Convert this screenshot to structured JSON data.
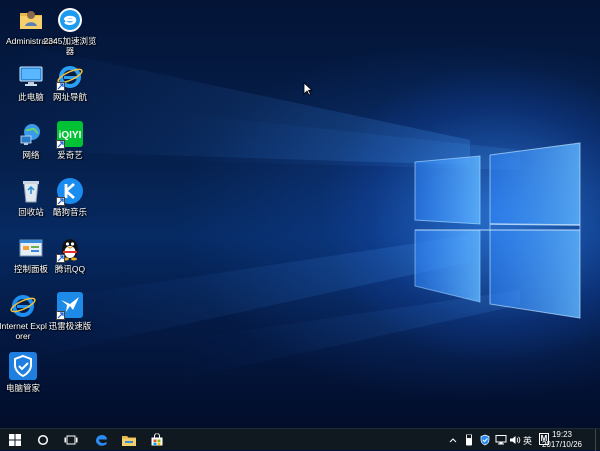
{
  "desktop": {
    "icons": [
      {
        "label": "Administrator",
        "icon": "user-folder-icon"
      },
      {
        "label": "2345加速浏览器",
        "icon": "browser-2345-icon"
      },
      {
        "label": "此电脑",
        "icon": "this-pc-icon"
      },
      {
        "label": "网址导航",
        "icon": "ie-navigation-icon"
      },
      {
        "label": "网络",
        "icon": "network-icon"
      },
      {
        "label": "爱奇艺",
        "icon": "iqiyi-icon"
      },
      {
        "label": "回收站",
        "icon": "recycle-bin-icon"
      },
      {
        "label": "酷狗音乐",
        "icon": "kugou-icon"
      },
      {
        "label": "控制面板",
        "icon": "control-panel-icon"
      },
      {
        "label": "腾讯QQ",
        "icon": "qq-penguin-icon"
      },
      {
        "label": "Internet Explorer",
        "icon": "internet-explorer-icon"
      },
      {
        "label": "迅雷极速版",
        "icon": "xunlei-icon"
      },
      {
        "label": "电脑管家",
        "icon": "pc-manager-shield-icon"
      }
    ]
  },
  "taskbar": {
    "pinned": [
      "start-windows-icon",
      "cortana-circle-icon",
      "task-view-icon",
      "edge-icon",
      "file-explorer-icon",
      "store-icon"
    ],
    "tray": {
      "ime": "英",
      "ime_mode": "M",
      "time": "19:23",
      "date": "2017/10/26"
    }
  },
  "colors": {
    "taskbar": "#101820",
    "accent": "#76b9ed",
    "wallpaper_glow": "#3c96ff"
  }
}
